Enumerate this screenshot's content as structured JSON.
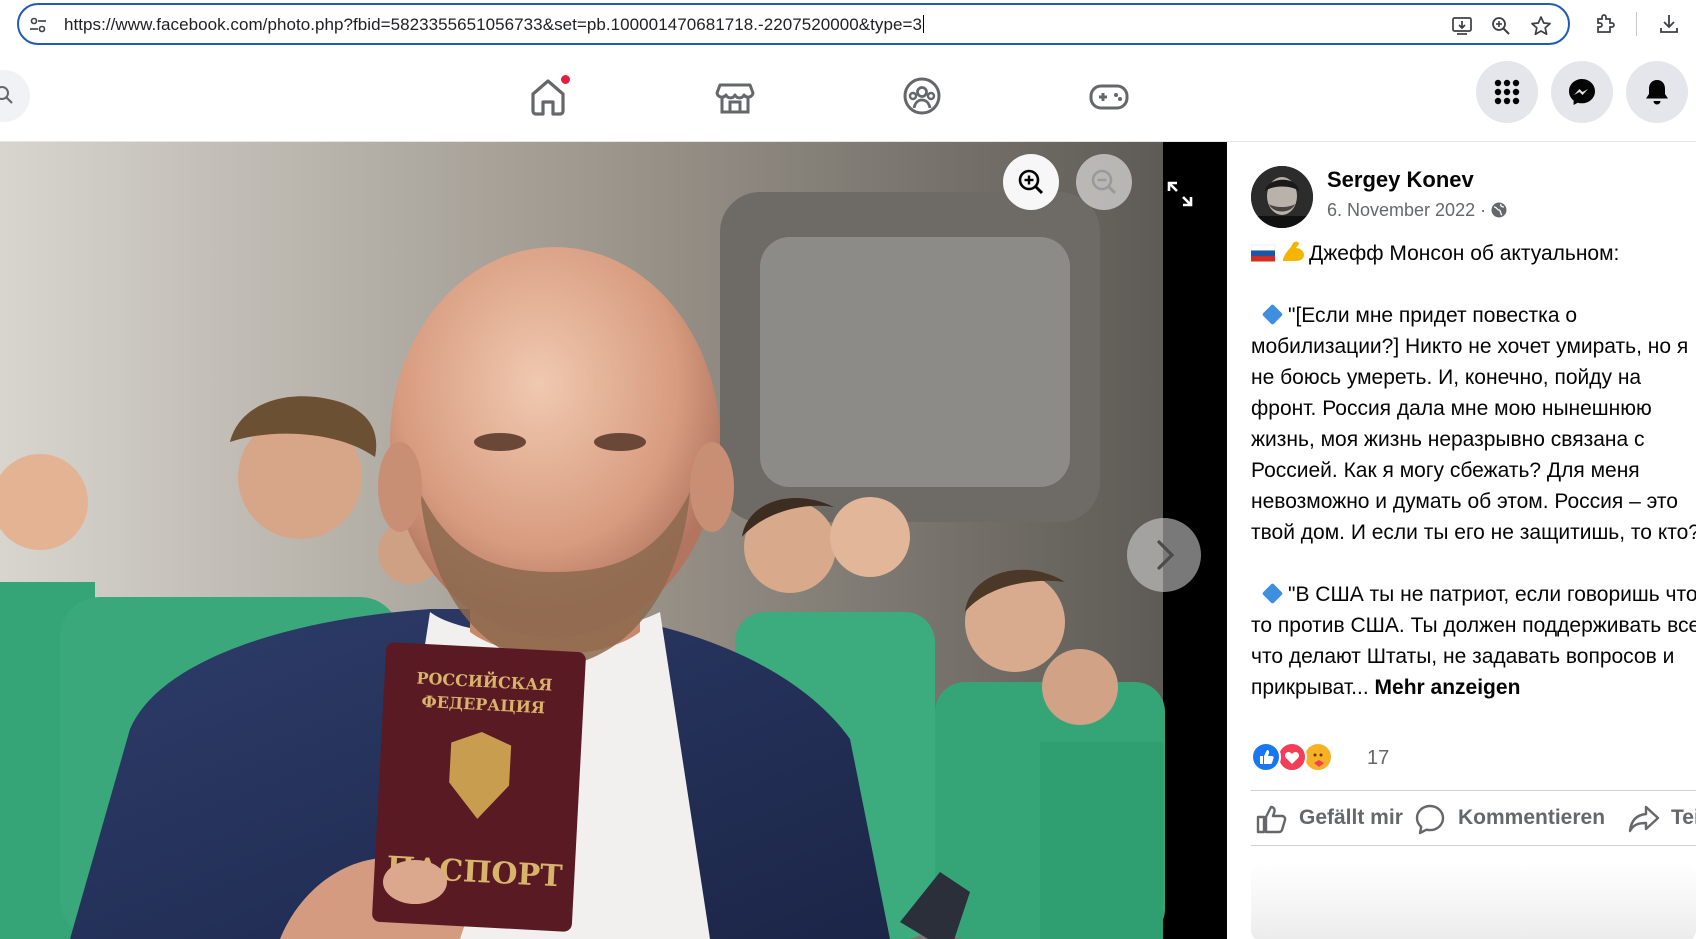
{
  "browser": {
    "url": "https://www.facebook.com/photo.php?fbid=5823355651056733&set=pb.100001470681718.-2207520000&type=3"
  },
  "nav": {
    "tabs": [
      "home",
      "marketplace",
      "groups",
      "gaming"
    ],
    "home_notification": true
  },
  "post": {
    "author": "Sergey Konev",
    "date": "6. November 2022 ·",
    "lines": [
      "Джефф Монсон об актуальном:",
      "",
      "\"[Если мне придет повестка о",
      "мобилизации?] Никто не хочет умирать, но я",
      "не боюсь умереть. И, конечно, пойду на",
      "фронт. Россия дала мне мою нынешнюю",
      "жизнь, моя жизнь неразрывно связана с",
      "Россией. Как я могу сбежать? Для меня",
      "невозможно и думать об этом. Россия – это",
      "твой дом. И если ты его не защитишь, то кто?",
      "",
      "\"В США ты не патриот, если говоришь что-",
      "то против США. Ты должен поддерживать все,",
      "что делают Штаты, не задавать вопросов и",
      "прикрыват..."
    ],
    "more_label": "Mehr anzeigen",
    "reaction_count": "17",
    "actions": {
      "like": "Gefällt mir",
      "comment": "Kommentieren",
      "share": "Teilen"
    }
  },
  "photo": {
    "passport_line1": "РОССИЙСКАЯ",
    "passport_line2": "ФЕДЕРАЦИЯ",
    "passport_word": "ПАСПОРТ"
  },
  "colors": {
    "omnibox_border": "#1f5bb7",
    "like_blue": "#1877f2",
    "love_red": "#f33e58",
    "notification_red": "#e41e3f"
  }
}
